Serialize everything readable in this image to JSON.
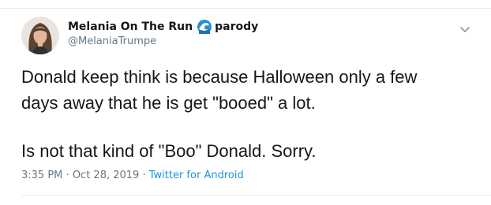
{
  "tweet": {
    "display_name": "Melania On The Run",
    "name_suffix": "parody",
    "name_emoji_icon": "water-wave-icon",
    "handle": "@MelaniaTrumpe",
    "body_line_1": "Donald keep think is because Halloween only a few",
    "body_line_2": "days away that he is get \"booed\" a lot.",
    "body_line_3": "Is not that kind of \"Boo\" Donald.  Sorry.",
    "time": "3:35 PM",
    "separator": "·",
    "date": "Oct 28, 2019",
    "source": "Twitter for Android",
    "menu_icon": "chevron-down-icon",
    "colors": {
      "text": "#14171a",
      "secondary": "#657786",
      "link": "#1b95e0",
      "border": "#e6ecf0"
    }
  }
}
